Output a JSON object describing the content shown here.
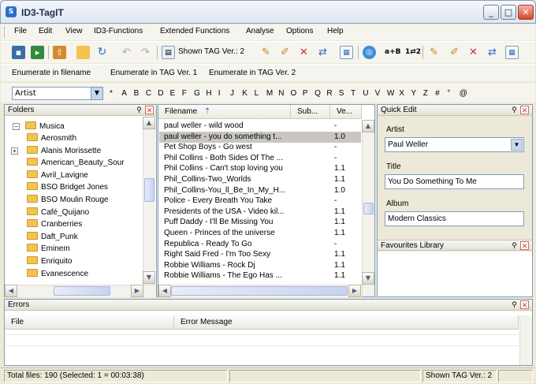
{
  "window": {
    "title": "ID3-TagIT",
    "app_icon": "S",
    "controls": [
      "_",
      "□",
      "✕"
    ]
  },
  "menu": [
    "File",
    "Edit",
    "View",
    "ID3-Functions",
    "Extended Functions",
    "Analyse",
    "Options",
    "Help"
  ],
  "toolbar": {
    "shown_tag_label": "Shown TAG Ver.: 2"
  },
  "toolbar2": {
    "enum_filename": "Enumerate in filename",
    "enum_tag1": "Enumerate in TAG Ver. 1",
    "enum_tag2": "Enumerate in TAG Ver. 2"
  },
  "filter": {
    "field": "Artist",
    "letters": [
      "*",
      "A",
      "B",
      "C",
      "D",
      "E",
      "F",
      "G",
      "H",
      "I",
      "J",
      "K",
      "L",
      "M",
      "N",
      "O",
      "P",
      "Q",
      "R",
      "S",
      "T",
      "U",
      "V",
      "W",
      "X",
      "Y",
      "Z",
      "#",
      "°",
      "@"
    ]
  },
  "folders": {
    "title": "Folders",
    "root": "Musica",
    "items": [
      "Aerosmith",
      "Alanis Morissette",
      "American_Beauty_Sour",
      "Avril_Lavigne",
      "BSO Bridget Jones",
      "BSO Moulin Rouge",
      "Café_Quijano",
      "Cranberries",
      "Daft_Punk",
      "Eminem",
      "Enriquito",
      "Evanescence"
    ]
  },
  "files": {
    "columns": {
      "name": "Filename",
      "sub": "Sub...",
      "ver": "Ve..."
    },
    "rows": [
      {
        "name": "paul weller - wild wood",
        "sub": "",
        "ver": "-"
      },
      {
        "name": "paul weller - you do something t...",
        "sub": "",
        "ver": "1.0"
      },
      {
        "name": "Pet Shop Boys - Go west",
        "sub": "",
        "ver": "-"
      },
      {
        "name": "Phil Collins - Both Sides Of The ...",
        "sub": "",
        "ver": "-"
      },
      {
        "name": "Phil Collins - Can't stop loving you",
        "sub": "",
        "ver": "1.1"
      },
      {
        "name": "Phil_Collins-Two_Worlds",
        "sub": "",
        "ver": "1.1"
      },
      {
        "name": "Phil_Collins-You_ll_Be_In_My_H...",
        "sub": "",
        "ver": "1.0"
      },
      {
        "name": "Police - Every Breath You Take",
        "sub": "",
        "ver": "-"
      },
      {
        "name": "Presidents of the USA - Video kil...",
        "sub": "",
        "ver": "1.1"
      },
      {
        "name": "Puff Daddy - I'll Be Missing You",
        "sub": "",
        "ver": "1.1"
      },
      {
        "name": "Queen - Princes of the universe",
        "sub": "",
        "ver": "1.1"
      },
      {
        "name": "Republica - Ready To Go",
        "sub": "",
        "ver": "-"
      },
      {
        "name": "Right Said Fred - I'm Too Sexy",
        "sub": "",
        "ver": "1.1"
      },
      {
        "name": "Robbie Williams - Rock Dj",
        "sub": "",
        "ver": "1.1"
      },
      {
        "name": "Robbie Williams - The Ego Has ...",
        "sub": "",
        "ver": "1.1"
      }
    ]
  },
  "quick_edit": {
    "title": "Quick Edit",
    "artist_label": "Artist",
    "artist_value": "Paul Weller",
    "title_label": "Title",
    "title_value": "You Do Something To Me",
    "album_label": "Album",
    "album_value": "Modern Classics"
  },
  "favourites": {
    "title": "Favourites Library"
  },
  "errors": {
    "title": "Errors",
    "col_file": "File",
    "col_message": "Error Message"
  },
  "status": {
    "total": "Total files: 190 (Selected: 1 = 00:03:38)",
    "shown_tag": "Shown TAG Ver.: 2"
  },
  "colors": {
    "selected_row": "#c9c7c0",
    "folder": "#f3c44f",
    "border": "#7f9db9"
  }
}
